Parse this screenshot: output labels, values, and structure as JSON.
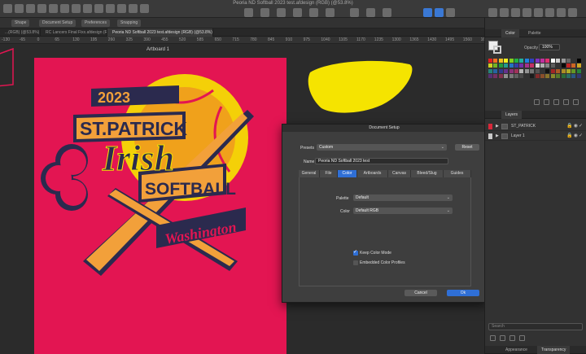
{
  "window": {
    "title": "Peoria ND Softball 2023 test.afdesign (RGB) (@53.8%)"
  },
  "context_bar": {
    "buttons": [
      "Shape",
      "Document Setup",
      "Preferences",
      "Snapping"
    ]
  },
  "tabs": [
    {
      "label": "...(RGB) (@53.8%) - 3"
    },
    {
      "label": "RC Lancers Final Fixx.afdesign (RGB) (@5...)"
    },
    {
      "label": "Peoria ND Softball 2023 test.afdesign (RGB) (@53.8%)",
      "active": true
    }
  ],
  "ruler": {
    "ticks": [
      "-130",
      "-65",
      "0",
      "65",
      "130",
      "195",
      "260",
      "325",
      "390",
      "455",
      "520",
      "585",
      "650",
      "715",
      "780",
      "845",
      "910",
      "975",
      "1040",
      "1105",
      "1170",
      "1235",
      "1300",
      "1365",
      "1430",
      "1495",
      "1560",
      "16"
    ]
  },
  "canvas": {
    "artboard_label": "Artboard 1",
    "artwork_text": {
      "year": "2023",
      "line1": "ST.PATRICK",
      "line2": "Irish",
      "line3": "SOFTBALL",
      "line4": "Washington"
    },
    "colors": {
      "artboard": "#e31552",
      "yellow": "#f5e400",
      "navy": "#2b2a4e",
      "orange": "#f2a03a"
    }
  },
  "dialog": {
    "title": "Document Setup",
    "presets_label": "Presets",
    "presets_value": "Custom",
    "reset_label": "Reset",
    "name_label": "Name",
    "name_value": "Peoria ND Softball 2023 test",
    "tabs": [
      "General",
      "File",
      "Color",
      "Artboards",
      "Canvas",
      "Bleed/Slug",
      "Guides"
    ],
    "active_tab": "Color",
    "palette_label": "Palette",
    "palette_value": "Default",
    "color_label": "Color",
    "color_value": "Default RGB",
    "keep_color_mode": "Keep Color Mode",
    "embedded_profiles": "Embedded Color Profiles",
    "cancel_label": "Cancel",
    "ok_label": "Ok"
  },
  "right_panel": {
    "color_tabs": [
      "Color",
      "Palette"
    ],
    "opacity_label": "Opacity",
    "opacity_value": "100%",
    "layers_tab": "Layers",
    "layers": [
      {
        "name": "ST_PATRICK",
        "color": "#d8283a"
      },
      {
        "name": "Layer 1",
        "color": "#c9c9c9"
      }
    ],
    "search_placeholder": "Search",
    "bottom_tabs": [
      "Appearance",
      "Transparency"
    ]
  }
}
